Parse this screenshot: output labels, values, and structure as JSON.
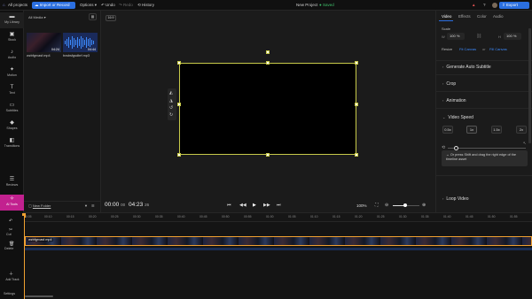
{
  "topbar": {
    "all_projects": "All projects",
    "import_label": "Import or Record",
    "options": "Options",
    "undo": "Undo",
    "redo": "Redo",
    "history": "History",
    "project_title": "New Project",
    "saved": "Saved",
    "export": "Export"
  },
  "rail": {
    "items": [
      {
        "label": "My Library",
        "icon": "folder-icon"
      },
      {
        "label": "Stock",
        "icon": "stock-icon"
      },
      {
        "label": "Audio",
        "icon": "music-note-icon"
      },
      {
        "label": "Motion",
        "icon": "motion-icon"
      },
      {
        "label": "Text",
        "icon": "text-icon"
      },
      {
        "label": "Subtitles",
        "icon": "subtitles-icon"
      },
      {
        "label": "Shapes",
        "icon": "shapes-icon"
      },
      {
        "label": "Transitions",
        "icon": "transitions-icon"
      },
      {
        "label": "Reviews",
        "icon": "reviews-icon"
      },
      {
        "label": "AI Tools",
        "icon": "ai-tools-icon"
      }
    ]
  },
  "media": {
    "filter": "All Media",
    "items": [
      {
        "name": "wzbfgrvasf.mp4",
        "duration": "04:24"
      },
      {
        "name": "bxsbsfgsdbrf.mp3",
        "duration": "04:44"
      }
    ],
    "new_folder": "New Folder"
  },
  "preview": {
    "aspect": "16:9",
    "current_time": "00:00",
    "current_frames": "00",
    "total_time": "04:23",
    "total_frames": "26",
    "zoom": "100%"
  },
  "props": {
    "tabs": [
      "Video",
      "Effects",
      "Color",
      "Audio"
    ],
    "scale_label": "Scale",
    "scale_w": "100",
    "scale_h": "100",
    "resize_label": "Resize",
    "fit_canvas": "Fit Canvas",
    "or": "or",
    "fill_canvas": "Fill Canvas",
    "sections": [
      "Generate Auto Subtitle",
      "Crop",
      "Animation",
      "Video Speed"
    ],
    "speeds": [
      "0.5x",
      "1x",
      "1.5x",
      "2x"
    ],
    "hint": "Or press Shift and drag the right edge of the timeline asset",
    "loop": "Loop Video"
  },
  "timeline": {
    "track_label": "wzbfgrvasf.mp4",
    "ticks": [
      "00:05",
      "00:10",
      "00:15",
      "00:20",
      "00:25",
      "00:30",
      "00:35",
      "00:40",
      "00:45",
      "00:50",
      "00:55",
      "01:00",
      "01:05",
      "01:10",
      "01:15",
      "01:20",
      "01:25",
      "01:30",
      "01:35",
      "01:40",
      "01:45",
      "01:50",
      "01:55"
    ],
    "left_tools": [
      {
        "label": "Split",
        "icon": "undo-icon"
      },
      {
        "label": "Cut",
        "icon": "cut-icon"
      },
      {
        "label": "Delete",
        "icon": "trash-icon"
      },
      {
        "label": "Add Track",
        "icon": "add-track-icon"
      },
      {
        "label": "Settings",
        "icon": "gear-icon"
      }
    ]
  }
}
